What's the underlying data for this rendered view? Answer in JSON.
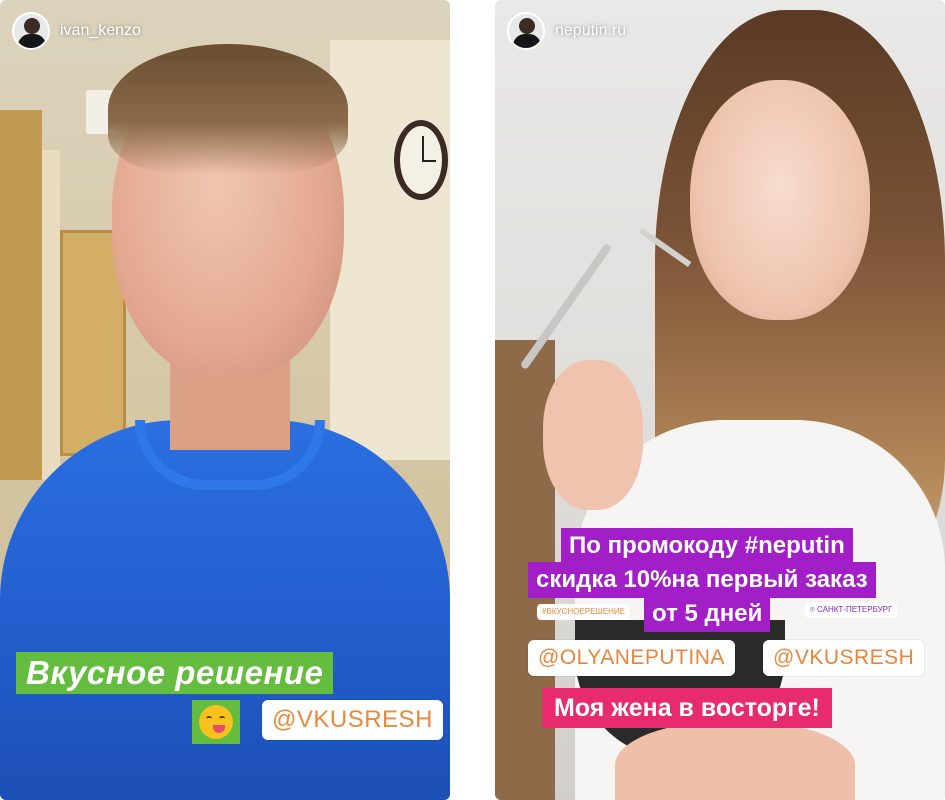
{
  "stories": [
    {
      "username": "ivan_kenzo",
      "caption": "Вкусное решение",
      "emoji": "savoring-food-emoji",
      "mention": "@VKUSRESH"
    },
    {
      "username": "neputin.ru",
      "promo_lines": [
        "По промокоду #neputin",
        "скидка 10%на первый заказ",
        "от 5 дней"
      ],
      "hashtag_tag": "#ВКУСНОЕРЕШЕНИЕ",
      "location_tag": "САНКТ-ПЕТЕРБУРГ",
      "mentions": [
        "@OLYANEPUTINA",
        "@VKUSRESH"
      ],
      "caption": "Моя жена в восторге!"
    }
  ],
  "colors": {
    "green_caption": "#64bd3e",
    "purple_promo": "#a21ec7",
    "pink_caption": "#e72b6e",
    "mention_text": "#e88a3a"
  }
}
